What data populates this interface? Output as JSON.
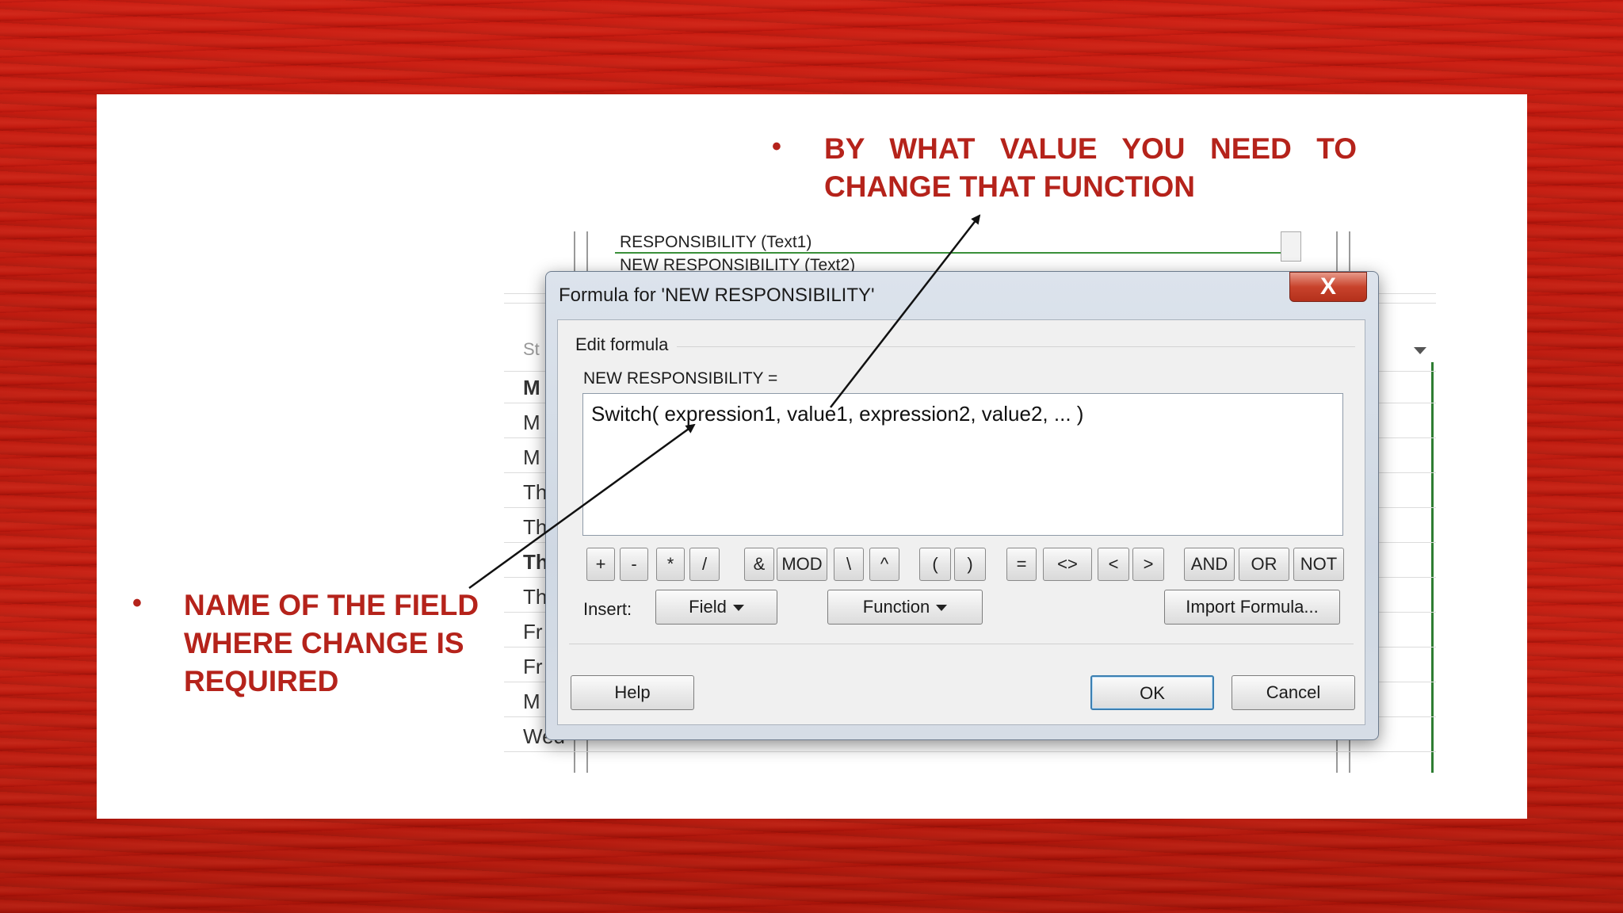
{
  "slide": {
    "top_bullet": "BY WHAT VALUE YOU NEED TO CHANGE THAT FUNCTION",
    "left_bullet": "NAME OF THE FIELD WHERE CHANGE IS REQUIRED",
    "bullet_char": "•"
  },
  "background_sheet": {
    "list_item_1": "RESPONSIBILITY (Text1)",
    "list_item_2": "NEW RESPONSIBILITY (Text2)",
    "column_header": "St",
    "rows": [
      "M",
      "M",
      "M",
      "Th",
      "Th",
      "Th",
      "Th",
      "Fr",
      "Fr",
      "M",
      "Wed"
    ]
  },
  "dialog": {
    "title": "Formula for 'NEW RESPONSIBILITY'",
    "close_label": "X",
    "group_label": "Edit formula",
    "field_label": "NEW RESPONSIBILITY =",
    "formula_text": "Switch( expression1, value1, expression2, value2, ... )",
    "operators": [
      "+",
      "-",
      "*",
      "/",
      "&",
      "MOD",
      "\\",
      "^",
      "(",
      ")",
      "=",
      "<>",
      "<",
      ">",
      "AND",
      "OR",
      "NOT"
    ],
    "insert_label": "Insert:",
    "field_button": "Field",
    "function_button": "Function",
    "import_button": "Import Formula...",
    "help_button": "Help",
    "ok_button": "OK",
    "cancel_button": "Cancel"
  },
  "colors": {
    "accent_text": "#b5231b",
    "slide_background": "#ffffff",
    "texture_background": "#c81b10"
  }
}
